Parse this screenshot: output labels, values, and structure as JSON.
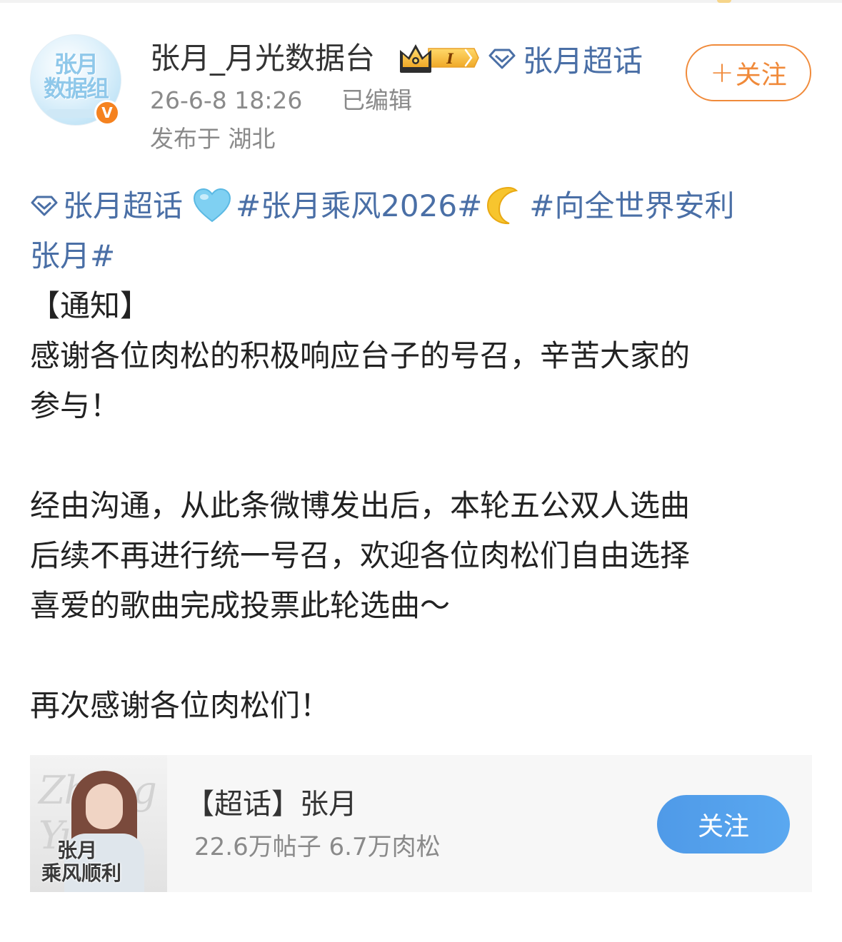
{
  "post": {
    "username": "张月_月光数据台",
    "super_topic_link": "张月超话",
    "timestamp": "26-6-8 18:26",
    "edited": "已编辑",
    "location": "发布于 湖北",
    "follow_label": "关注",
    "content": {
      "topic_tag": "张月超话",
      "hashtag_1": "#张月乘风2026#",
      "hashtag_2_part1": "#向全世界安利",
      "hashtag_2_part2": "张月#",
      "notice": "【通知】",
      "para1_line1": "感谢各位肉松的积极响应台子的号召，辛苦大家的",
      "para1_line2": "参与！",
      "para2_line1": "经由沟通，从此条微博发出后，本轮五公双人选曲",
      "para2_line2": "后续不再进行统一号召，欢迎各位肉松们自由选择",
      "para2_line3": "喜爱的歌曲完成投票此轮选曲～",
      "para3": "再次感谢各位肉松们！"
    }
  },
  "supertopic_card": {
    "poster_text_1": "张月",
    "poster_text_2": "乘风顺利",
    "poster_script": "Zhang Yue",
    "title": "【超话】张月",
    "stats": "22.6万帖子 6.7万肉松",
    "follow_label": "关注"
  },
  "badges": {
    "verified_mark": "V",
    "level_badge": "I"
  },
  "colors": {
    "link_blue": "#4a6fa6",
    "follow_orange": "#f08a3a",
    "verified_orange": "#f5821f",
    "card_button_blue": "#4f9ae8",
    "meta_gray": "#8a8a8a"
  },
  "icons": [
    "diamond-icon",
    "crown-icon",
    "heart-emoji-icon",
    "moon-emoji-icon",
    "verified-icon",
    "plus-icon"
  ]
}
